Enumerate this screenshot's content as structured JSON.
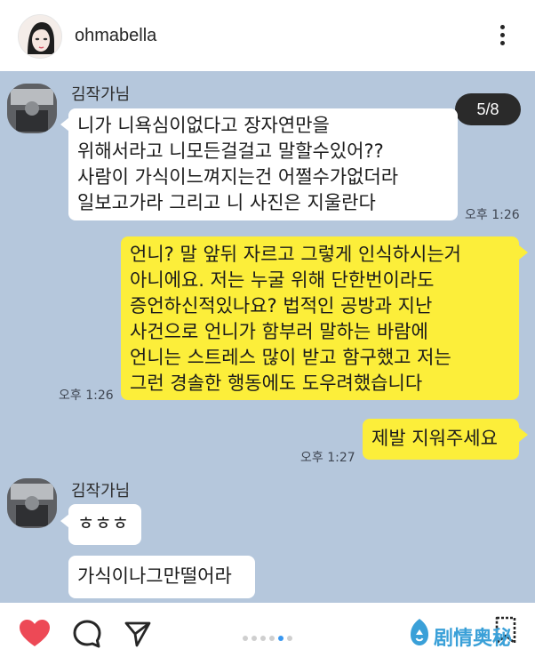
{
  "header": {
    "username": "ohmabella"
  },
  "chat": {
    "counter": "5/8",
    "messages": [
      {
        "sender": "김작가님",
        "text": "니가 니욕심이없다고 장자연만을\n위해서라고 니모든걸걸고 말할수있어??\n사람이 가식이느껴지는건 어쩔수가없더라\n일보고가라 그리고 니 사진은 지울란다",
        "time": "오후 1:26"
      },
      {
        "text": "언니? 말 앞뒤 자르고 그렇게 인식하시는거\n아니에요. 저는 누굴 위해 단한번이라도\n증언하신적있나요? 법적인 공방과 지난\n사건으로 언니가 함부러 말하는 바람에\n언니는 스트레스 많이 받고 함구했고 저는\n그런 경솔한 행동에도 도우려했습니다",
        "time": "오후 1:26"
      },
      {
        "text": "제발 지워주세요",
        "time": "오후 1:27"
      },
      {
        "sender": "김작가님",
        "text": "ㅎㅎㅎ"
      },
      {
        "text": "가식이나그만떨어라"
      }
    ]
  },
  "bottom": {
    "watermark": "剧情奥秘"
  },
  "colors": {
    "chat_bg": "#b5c7dc",
    "own_bubble": "#fcee3a",
    "other_bubble": "#ffffff",
    "like_red": "#ed4956",
    "active_dot": "#3897f0"
  },
  "icons": [
    "more-vertical-icon",
    "heart-icon",
    "comment-icon",
    "share-icon",
    "bookmark-icon"
  ]
}
